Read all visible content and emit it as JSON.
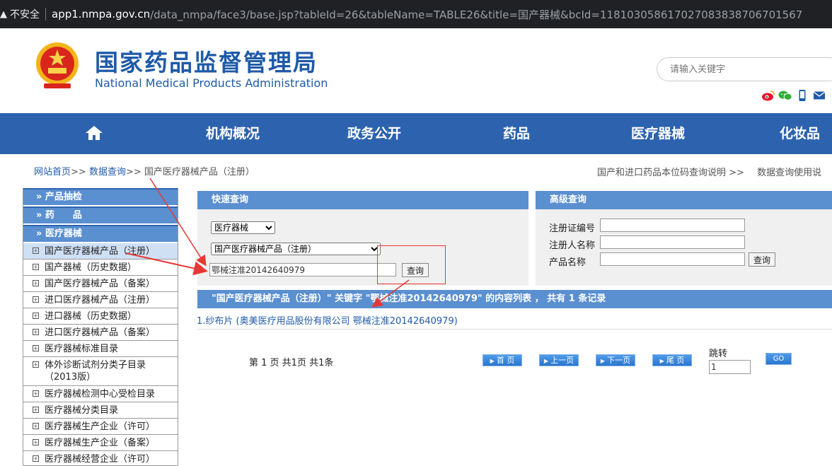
{
  "browser": {
    "insecure_label": "不安全",
    "url_host": "app1.nmpa.gov.cn",
    "url_path": "/data_nmpa/face3/base.jsp?tableId=26&tableName=TABLE26&title=国产器械&bcId=118103058617027083838706701567"
  },
  "header": {
    "title_cn": "国家药品监督管理局",
    "title_en": "National Medical Products Administration",
    "search_placeholder": "请输入关键字"
  },
  "nav": {
    "items": [
      "机构概况",
      "政务公开",
      "药品",
      "医疗器械",
      "化妆品"
    ]
  },
  "breadcrumb": {
    "home": "网站首页",
    "sep": ">>",
    "data_query": "数据查询",
    "current": "国产医疗器械产品（注册）",
    "right_1": "国产和进口药品本位码查询说明 >>",
    "right_2": "数据查询使用说"
  },
  "sidebar": {
    "heads": [
      "» 产品抽检",
      "» 药　　品",
      "» 医疗器械"
    ],
    "items": [
      "国产医疗器械产品（注册）",
      "国产器械（历史数据）",
      "国产医疗器械产品（备案）",
      "进口医疗器械产品（注册）",
      "进口器械（历史数据）",
      "进口医疗器械产品（备案）",
      "医疗器械标准目录",
      "体外诊断试剂分类子目录（2013版）",
      "医疗器械检测中心受检目录",
      "医疗器械分类目录",
      "医疗器械生产企业（许可）",
      "医疗器械生产企业（备案）",
      "医疗器械经营企业（许可）"
    ]
  },
  "quick": {
    "title": "快速查询",
    "category": "医疗器械",
    "table": "国产医疗器械产品（注册）",
    "keyword": "鄂械注准20142640979",
    "query_btn": "查询"
  },
  "advanced": {
    "title": "高级查询",
    "labels": [
      "注册证编号",
      "注册人名称",
      "产品名称"
    ],
    "query_btn": "查询"
  },
  "results": {
    "header": "\"国产医疗器械产品（注册）\" 关键字 \"鄂械注准20142640979\" 的内容列表 ， 共有 1 条记录",
    "item": "1.纱布片 (奥美医疗用品股份有限公司 鄂械注准20142640979)",
    "page_info": "第 1 页 共1页 共1条",
    "first": "首 页",
    "prev": "上一页",
    "next": "下一页",
    "last": "尾 页",
    "jump_label": "跳转",
    "jump_value": "1",
    "go": "GO"
  },
  "colors": {
    "nav_blue": "#2d63ae",
    "panel_blue": "#5a8fd0",
    "annotation_red": "#e53935"
  }
}
